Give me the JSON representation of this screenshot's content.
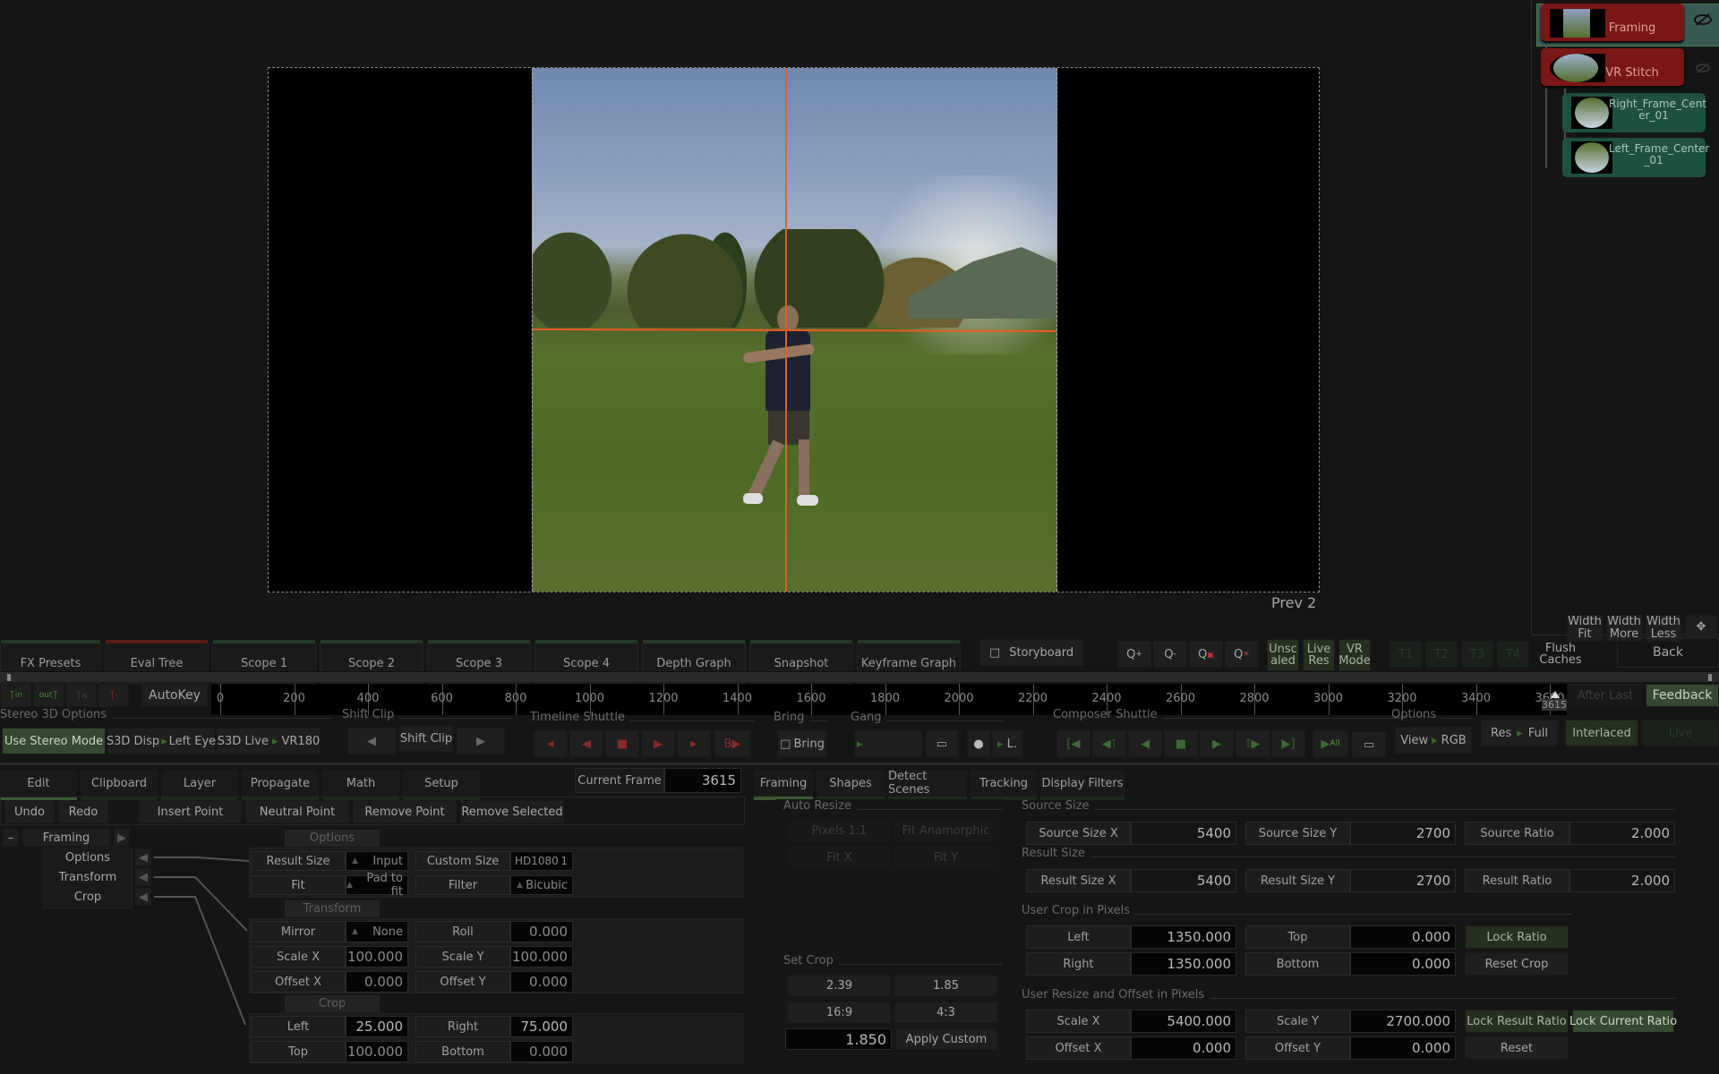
{
  "viewer": {
    "label": "Prev 2",
    "crosshair_color": "#f05a1e"
  },
  "node_tree": {
    "nodes": [
      {
        "label": "Framing",
        "color": "#7a1616",
        "visibility_icon": "eye-off-icon"
      },
      {
        "label": "VR Stitch",
        "color": "#7a1616",
        "visibility_icon": "eye-off-icon"
      },
      {
        "label": "Right_Frame_Cent er_01",
        "color": "#1d5040"
      },
      {
        "label": "Left_Frame_Center _01",
        "color": "#1d5040"
      }
    ],
    "width_buttons": [
      "Width Fit",
      "Width More",
      "Width Less"
    ],
    "move_icon": "move-icon"
  },
  "view_tabs": [
    {
      "label": "FX Presets",
      "accent": "green"
    },
    {
      "label": "Eval Tree",
      "accent": "red"
    },
    {
      "label": "Scope 1",
      "accent": "green"
    },
    {
      "label": "Scope 2",
      "accent": "green"
    },
    {
      "label": "Scope 3",
      "accent": "green"
    },
    {
      "label": "Scope 4",
      "accent": "green"
    },
    {
      "label": "Depth Graph",
      "accent": "green"
    },
    {
      "label": "Snapshot",
      "accent": "green"
    },
    {
      "label": "Keyframe Graph",
      "accent": "green"
    }
  ],
  "toolbar": {
    "storyboard": "Storyboard",
    "zoom_icons": [
      "zoom-in-icon",
      "zoom-out-icon",
      "zoom-region-icon",
      "zoom-reset-icon"
    ],
    "unscaled": "Unsc aled",
    "live_res": "Live Res",
    "vr_mode": "VR Mode",
    "t_buttons": [
      "T1",
      "T2",
      "T3",
      "T4"
    ],
    "flush_caches": "Flush Caches",
    "back": "Back"
  },
  "timeline": {
    "autokey": "AutoKey",
    "key_buttons": [
      "in",
      "out"
    ],
    "ticks": [
      "0",
      "200",
      "400",
      "600",
      "800",
      "1000",
      "1200",
      "1400",
      "1600",
      "1800",
      "2000",
      "2200",
      "2400",
      "2600",
      "2800",
      "3000",
      "3200",
      "3400",
      "3600"
    ],
    "current_marker": "3615",
    "after_last": "After Last",
    "feedback": "Feedback"
  },
  "controls": {
    "stereo_title": "Stereo 3D Options",
    "use_stereo": "Use Stereo Mode",
    "s3d_disp": "S3D Disp",
    "left_eye": "Left Eye",
    "s3d_live": "S3D Live",
    "vr180": "VR180",
    "shift_clip_title": "Shift Clip",
    "shift_clip": "Shift Clip",
    "timeline_shuttle_title": "Timeline Shuttle",
    "bring_title": "Bring",
    "bring": "Bring",
    "gang_title": "Gang",
    "gang_l": "L.",
    "composer_shuttle_title": "Composer Shuttle",
    "all": "All",
    "options_title": "Options",
    "view": "View",
    "rgb": "RGB",
    "res": "Res",
    "full": "Full",
    "interlaced": "Interlaced",
    "live": "Live"
  },
  "edit_panel": {
    "tabs": [
      "Edit",
      "Clipboard",
      "Layer",
      "Propagate",
      "Math",
      "Setup"
    ],
    "current_frame_label": "Current Frame",
    "current_frame": "3615",
    "actions": [
      "Undo",
      "Redo",
      "Insert Point",
      "Neutral Point",
      "Remove Point",
      "Remove Selected"
    ],
    "tree_root": "Framing",
    "tree_items": [
      "Options",
      "Transform",
      "Crop"
    ],
    "options_header": "Options",
    "result_size_label": "Result Size",
    "result_size_value": "Input",
    "custom_size_label": "Custom Size",
    "custom_size_value": "HD1080",
    "custom_size_num": "1",
    "fit_label": "Fit",
    "fit_value": "Pad to fit",
    "filter_label": "Filter",
    "filter_value": "Bicubic",
    "transform_header": "Transform",
    "mirror_label": "Mirror",
    "mirror_value": "None",
    "roll_label": "Roll",
    "roll_value": "0.000",
    "scale_x_label": "Scale X",
    "scale_x_value": "100.000",
    "scale_y_label": "Scale Y",
    "scale_y_value": "100.000",
    "offset_x_label": "Offset X",
    "offset_x_value": "0.000",
    "offset_y_label": "Offset Y",
    "offset_y_value": "0.000",
    "crop_header": "Crop",
    "crop_left_label": "Left",
    "crop_left_value": "25.000",
    "crop_right_label": "Right",
    "crop_right_value": "75.000",
    "crop_top_label": "Top",
    "crop_top_value": "100.000",
    "crop_bottom_label": "Bottom",
    "crop_bottom_value": "0.000"
  },
  "framing_panel": {
    "tabs": [
      "Framing",
      "Shapes",
      "Detect Scenes",
      "Tracking",
      "Display Filters"
    ],
    "auto_resize_title": "Auto Resize",
    "auto_resize_buttons": [
      "Pixels 1:1",
      "Fit Anamorphic",
      "Fit X",
      "Fit Y"
    ],
    "set_crop_title": "Set Crop",
    "set_crop_buttons": [
      "2.39",
      "1.85",
      "16:9",
      "4:3"
    ],
    "custom_ratio": "1.850",
    "apply_custom": "Apply Custom",
    "source_size_title": "Source Size",
    "source_size_x_label": "Source Size X",
    "source_size_x": "5400",
    "source_size_y_label": "Source Size Y",
    "source_size_y": "2700",
    "source_ratio_label": "Source Ratio",
    "source_ratio": "2.000",
    "result_size_title": "Result Size",
    "result_size_x_label": "Result Size X",
    "result_size_x": "5400",
    "result_size_y_label": "Result Size Y",
    "result_size_y": "2700",
    "result_ratio_label": "Result Ratio",
    "result_ratio": "2.000",
    "user_crop_title": "User Crop in Pixels",
    "left_label": "Left",
    "left": "1350.000",
    "top_label": "Top",
    "top": "0.000",
    "right_label": "Right",
    "right": "1350.000",
    "bottom_label": "Bottom",
    "bottom": "0.000",
    "lock_ratio": "Lock Ratio",
    "reset_crop": "Reset Crop",
    "user_resize_title": "User Resize and Offset in Pixels",
    "scale_x_label": "Scale X",
    "scale_x": "5400.000",
    "scale_y_label": "Scale Y",
    "scale_y": "2700.000",
    "offset_x_label": "Offset X",
    "offset_x": "0.000",
    "offset_y_label": "Offset Y",
    "offset_y": "0.000",
    "lock_result_ratio": "Lock Result Ratio",
    "lock_current_ratio": "Lock Current Ratio",
    "reset": "Reset"
  }
}
